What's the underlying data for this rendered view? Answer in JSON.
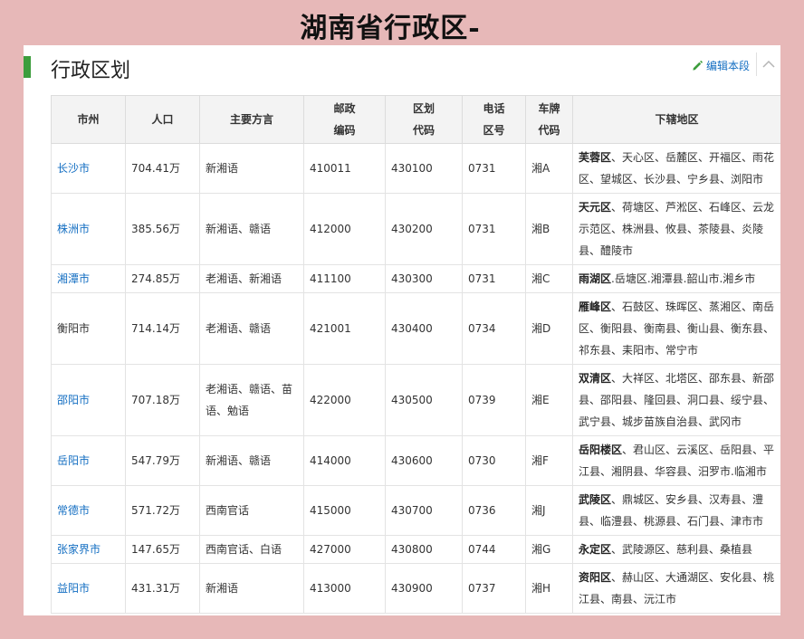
{
  "page_title": "湖南省行政区-",
  "section": {
    "title": "行政区划",
    "edit_label": "编辑本段",
    "pencil_icon": "pencil-icon",
    "collapse_icon": "chevron-up-icon"
  },
  "table": {
    "headers": [
      "市州",
      "人口",
      "主要方言",
      "邮政\n编码",
      "区划\n代码",
      "电话\n区号",
      "车牌\n代码",
      "下辖地区"
    ],
    "rows": [
      {
        "city": "长沙市",
        "link": true,
        "pop": "704.41万",
        "dialect": "新湘语",
        "post": "410011",
        "code": "430100",
        "tel": "0731",
        "plate": "湘A",
        "seat": "芙蓉区",
        "areas": "、天心区、岳麓区、开福区、雨花区、望城区、长沙县、宁乡县、浏阳市"
      },
      {
        "city": "株洲市",
        "link": true,
        "pop": "385.56万",
        "dialect": "新湘语、赣语",
        "post": "412000",
        "code": "430200",
        "tel": "0731",
        "plate": "湘B",
        "seat": "天元区",
        "areas": "、荷塘区、芦淞区、石峰区、云龙示范区、株洲县、攸县、茶陵县、炎陵县、醴陵市"
      },
      {
        "city": "湘潭市",
        "link": true,
        "pop": "274.85万",
        "dialect": "老湘语、新湘语",
        "post": "411100",
        "code": "430300",
        "tel": "0731",
        "plate": "湘C",
        "seat": "雨湖区",
        "areas": ".岳塘区.湘潭县.韶山市.湘乡市"
      },
      {
        "city": "衡阳市",
        "link": false,
        "pop": "714.14万",
        "dialect": "老湘语、赣语",
        "post": "421001",
        "code": "430400",
        "tel": "0734",
        "plate": "湘D",
        "seat": "雁峰区",
        "areas": "、石鼓区、珠晖区、蒸湘区、南岳区、衡阳县、衡南县、衡山县、衡东县、祁东县、耒阳市、常宁市"
      },
      {
        "city": "邵阳市",
        "link": true,
        "pop": "707.18万",
        "dialect": "老湘语、赣语、苗语、勉语",
        "post": "422000",
        "code": "430500",
        "tel": "0739",
        "plate": "湘E",
        "seat": "双清区",
        "areas": "、大祥区、北塔区、邵东县、新邵县、邵阳县、隆回县、洞口县、绥宁县、武宁县、城步苗族自治县、武冈市"
      },
      {
        "city": "岳阳市",
        "link": true,
        "pop": "547.79万",
        "dialect": "新湘语、赣语",
        "post": "414000",
        "code": "430600",
        "tel": "0730",
        "plate": "湘F",
        "seat": "岳阳楼区",
        "areas": "、君山区、云溪区、岳阳县、平江县、湘阴县、华容县、汨罗市.临湘市"
      },
      {
        "city": "常德市",
        "link": true,
        "pop": "571.72万",
        "dialect": "西南官话",
        "post": "415000",
        "code": "430700",
        "tel": "0736",
        "plate": "湘J",
        "seat": "武陵区",
        "areas": "、鼎城区、安乡县、汉寿县、澧县、临澧县、桃源县、石门县、津市市"
      },
      {
        "city": "张家界市",
        "link": true,
        "pop": "147.65万",
        "dialect": "西南官话、白语",
        "post": "427000",
        "code": "430800",
        "tel": "0744",
        "plate": "湘G",
        "seat": "永定区",
        "areas": "、武陵源区、慈利县、桑植县"
      },
      {
        "city": "益阳市",
        "link": true,
        "pop": "431.31万",
        "dialect": "新湘语",
        "post": "413000",
        "code": "430900",
        "tel": "0737",
        "plate": "湘H",
        "seat": "资阳区",
        "areas": "、赫山区、大通湖区、安化县、桃江县、南县、沅江市"
      }
    ]
  }
}
